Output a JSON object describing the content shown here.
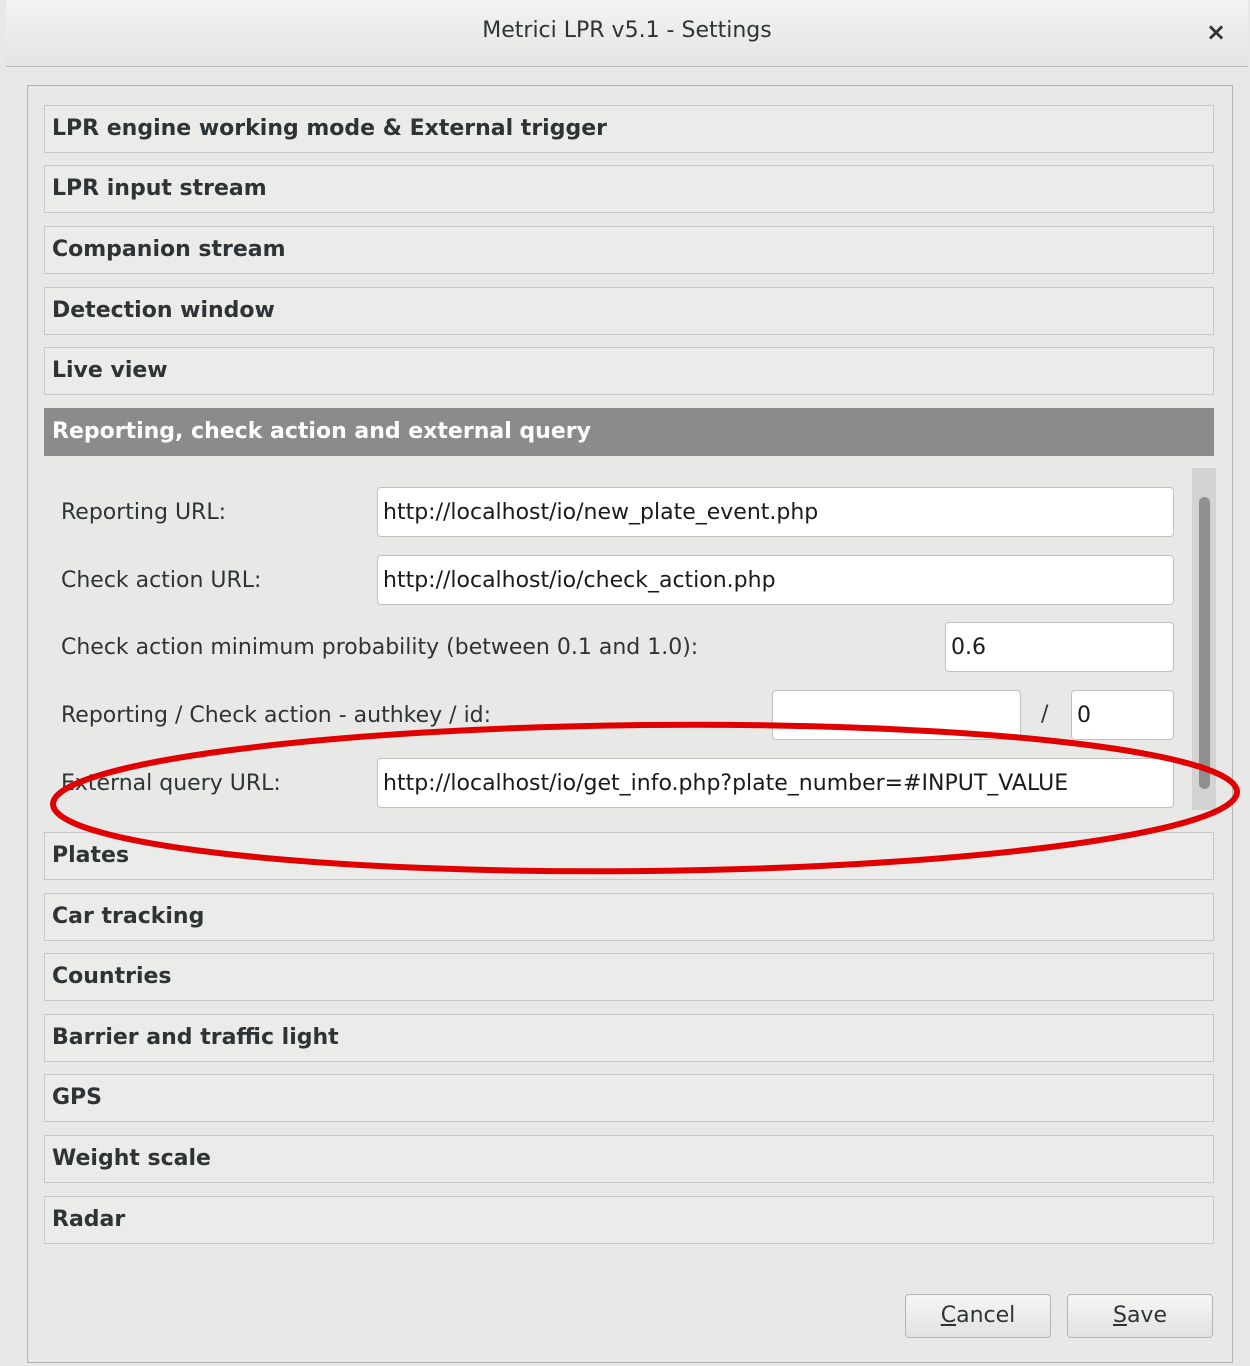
{
  "window": {
    "title": "Metrici LPR v5.1 - Settings",
    "close_symbol": "×"
  },
  "sections_top": [
    {
      "label": "LPR engine working mode & External trigger"
    },
    {
      "label": "LPR input stream"
    },
    {
      "label": "Companion stream"
    },
    {
      "label": "Detection window"
    },
    {
      "label": "Live view"
    }
  ],
  "active_section": {
    "label": "Reporting, check action and external query",
    "fields": {
      "reporting_url": {
        "label": "Reporting URL:",
        "value": "http://localhost/io/new_plate_event.php"
      },
      "check_action_url": {
        "label": "Check action URL:",
        "value": "http://localhost/io/check_action.php"
      },
      "min_probability": {
        "label": "Check action minimum probability (between 0.1 and 1.0):",
        "value": "0.6"
      },
      "authkey_id": {
        "label": "Reporting / Check action - authkey / id:",
        "authkey_value": "",
        "separator": "/",
        "id_value": "0"
      },
      "external_query_url": {
        "label": "External query URL:",
        "value": "http://localhost/io/get_info.php?plate_number=#INPUT_VALUE"
      }
    }
  },
  "sections_bottom": [
    {
      "label": "Plates"
    },
    {
      "label": "Car tracking"
    },
    {
      "label": "Countries"
    },
    {
      "label": "Barrier and traffic light"
    },
    {
      "label": "GPS"
    },
    {
      "label": "Weight scale"
    },
    {
      "label": "Radar"
    }
  ],
  "buttons": {
    "cancel": {
      "mnemonic": "C",
      "rest": "ancel"
    },
    "save": {
      "mnemonic": "S",
      "rest": "ave"
    }
  },
  "annotation": {
    "shape": "ellipse",
    "color": "#e00000"
  },
  "colors": {
    "active_header_bg": "#8b8b8b",
    "background": "#e8e8e7"
  }
}
